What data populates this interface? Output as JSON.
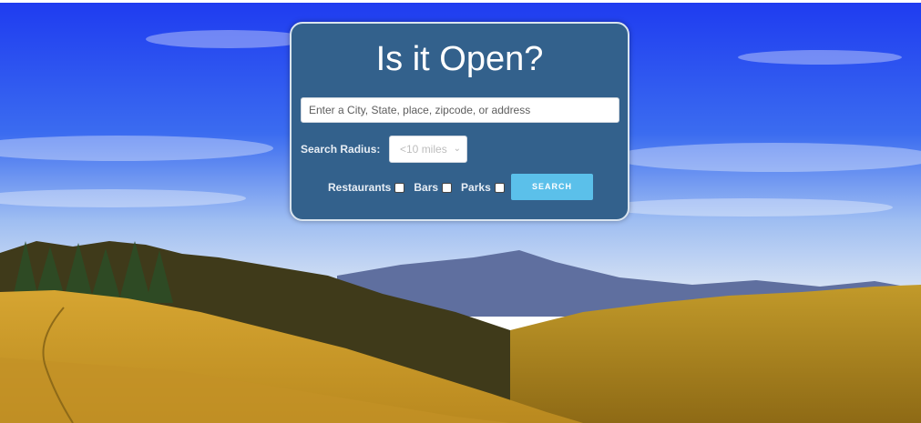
{
  "header": {
    "title": "Is it Open?"
  },
  "search": {
    "placeholder": "Enter a City, State, place, zipcode, or address",
    "value": ""
  },
  "radius": {
    "label": "Search Radius:",
    "selected": "<10 miles"
  },
  "filters": [
    {
      "label": "Restaurants",
      "checked": false
    },
    {
      "label": "Bars",
      "checked": false
    },
    {
      "label": "Parks",
      "checked": false
    }
  ],
  "actions": {
    "search_label": "SEARCH"
  },
  "colors": {
    "card": "#33618c",
    "button": "#5bc0ea",
    "sky": "#2244ee",
    "field": "#c89a2a"
  }
}
